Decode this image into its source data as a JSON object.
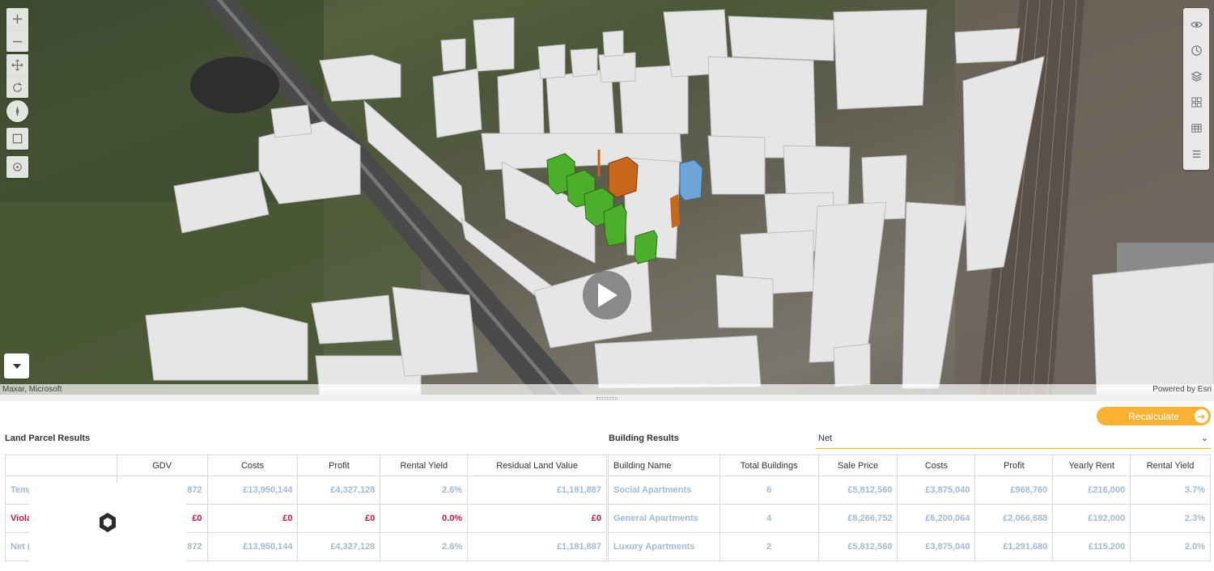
{
  "map": {
    "attribution_left": "Maxar, Microsoft",
    "attribution_right": "Powered by Esri",
    "left_tools": [
      "zoom-in",
      "zoom-out",
      "pan",
      "rotate",
      "compass",
      "select-box",
      "locate"
    ],
    "right_tools": [
      "eye",
      "clock",
      "layers",
      "grid",
      "table",
      "menu"
    ]
  },
  "colors": {
    "accent": "#f9b233",
    "link_blue": "#9fb9d6",
    "violation_red": "#c4183c",
    "building_green": "#4caf2c",
    "building_orange": "#c8661b",
    "building_blue": "#6ea5d8"
  },
  "actions": {
    "recalculate_label": "Recalculate"
  },
  "land_parcel": {
    "title": "Land Parcel Results",
    "headers": [
      "",
      "GDV",
      "Costs",
      "Profit",
      "Rental Yield",
      "Residual Land Value"
    ],
    "rows": [
      {
        "name": "Temp",
        "gdv": ",872",
        "costs": "£13,950,144",
        "profit": "£4,327,128",
        "yield": "2.6%",
        "rlv": "£1,181,887"
      },
      {
        "name": "Viola",
        "gdv": "£0",
        "costs": "£0",
        "profit": "£0",
        "yield": "0.0%",
        "rlv": "£0"
      },
      {
        "name": "Net (",
        "gdv": ",872",
        "costs": "£13,950,144",
        "profit": "£4,327,128",
        "yield": "2.6%",
        "rlv": "£1,181,887"
      }
    ]
  },
  "building": {
    "title": "Building Results",
    "mode_select": "Net",
    "headers": [
      "Building Name",
      "Total Buildings",
      "Sale Price",
      "Costs",
      "Profit",
      "Yearly Rent",
      "Rental Yield"
    ],
    "rows": [
      {
        "name": "Social Apartments",
        "total": "6",
        "sale": "£5,812,560",
        "costs": "£3,875,040",
        "profit": "£968,760",
        "rent": "£216,000",
        "yield": "3.7%"
      },
      {
        "name": "General Apartments",
        "total": "4",
        "sale": "£8,266,752",
        "costs": "£6,200,064",
        "profit": "£2,066,688",
        "rent": "£192,000",
        "yield": "2.3%"
      },
      {
        "name": "Luxury Apartments",
        "total": "2",
        "sale": "£5,812,560",
        "costs": "£3,875,040",
        "profit": "£1,291,680",
        "rent": "£115,200",
        "yield": "2.0%"
      }
    ]
  }
}
